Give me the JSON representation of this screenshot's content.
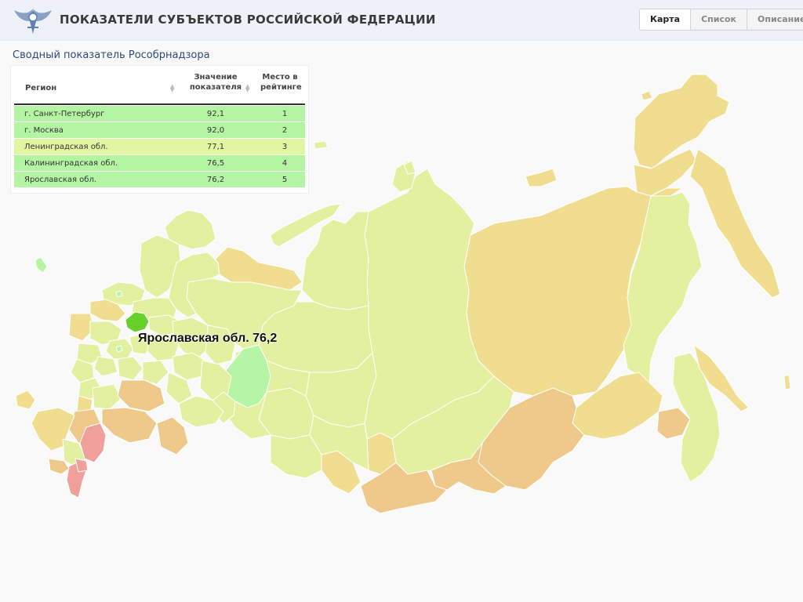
{
  "app": {
    "title": "ПОКАЗАТЕЛИ СУБЪЕКТОВ РОССИЙСКОЙ ФЕДЕРАЦИИ",
    "tabs": [
      {
        "label": "Карта",
        "active": true
      },
      {
        "label": "Список",
        "active": false
      },
      {
        "label": "Описание",
        "active": false
      }
    ]
  },
  "panel": {
    "title": "Сводный показатель Рособрнадзора"
  },
  "table": {
    "headers": {
      "region": "Регион",
      "value_line1": "Значение",
      "value_line2": "показателя",
      "place_line1": "Место в",
      "place_line2": "рейтинге"
    },
    "rows": [
      {
        "region": "г. Санкт-Петербург",
        "value": "92,1",
        "place": "1",
        "color": "#b3f5a3"
      },
      {
        "region": "г. Москва",
        "value": "92,0",
        "place": "2",
        "color": "#b3f5a3"
      },
      {
        "region": "Ленинградская обл.",
        "value": "77,1",
        "place": "3",
        "color": "#e2f5a0"
      },
      {
        "region": "Калининградская обл.",
        "value": "76,5",
        "place": "4",
        "color": "#b3f5a3"
      },
      {
        "region": "Ярославская обл.",
        "value": "76,2",
        "place": "5",
        "color": "#b3f5a3"
      }
    ]
  },
  "map": {
    "highlight_label": "Ярославская обл. 76,2",
    "colors": {
      "base": "#e2f0a0",
      "medium": "#f0dd90",
      "orange": "#efc98a",
      "low": "#f0a09a",
      "top": "#b5f5a5",
      "highlight": "#66d12a"
    }
  }
}
